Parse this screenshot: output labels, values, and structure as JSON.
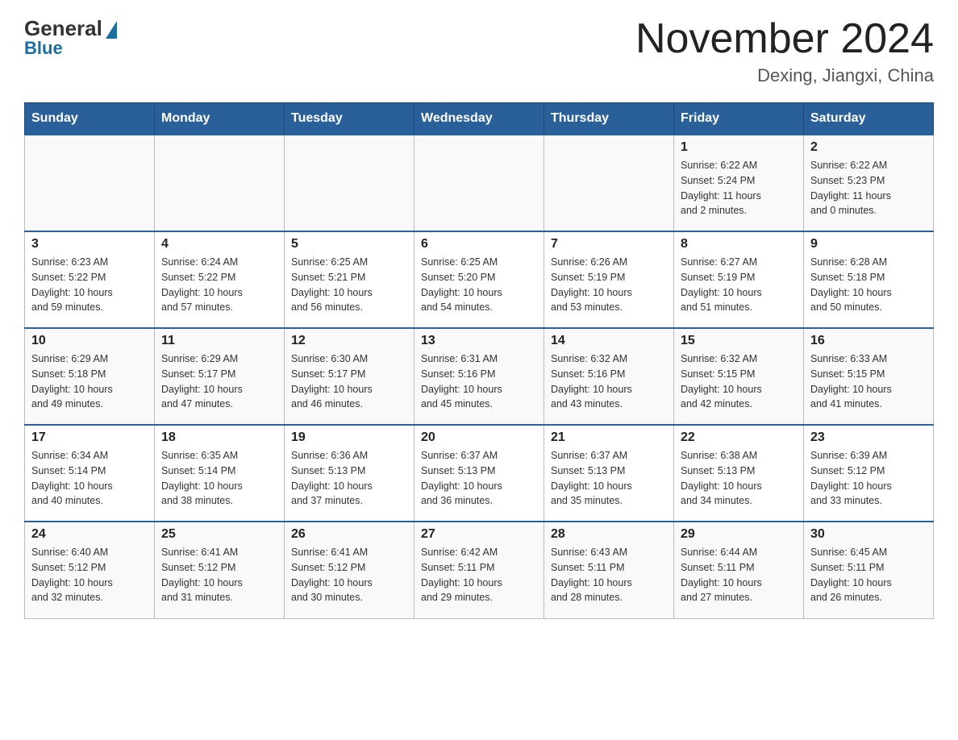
{
  "logo": {
    "general": "General",
    "blue": "Blue"
  },
  "title": "November 2024",
  "location": "Dexing, Jiangxi, China",
  "weekdays": [
    "Sunday",
    "Monday",
    "Tuesday",
    "Wednesday",
    "Thursday",
    "Friday",
    "Saturday"
  ],
  "weeks": [
    [
      {
        "day": "",
        "info": ""
      },
      {
        "day": "",
        "info": ""
      },
      {
        "day": "",
        "info": ""
      },
      {
        "day": "",
        "info": ""
      },
      {
        "day": "",
        "info": ""
      },
      {
        "day": "1",
        "info": "Sunrise: 6:22 AM\nSunset: 5:24 PM\nDaylight: 11 hours\nand 2 minutes."
      },
      {
        "day": "2",
        "info": "Sunrise: 6:22 AM\nSunset: 5:23 PM\nDaylight: 11 hours\nand 0 minutes."
      }
    ],
    [
      {
        "day": "3",
        "info": "Sunrise: 6:23 AM\nSunset: 5:22 PM\nDaylight: 10 hours\nand 59 minutes."
      },
      {
        "day": "4",
        "info": "Sunrise: 6:24 AM\nSunset: 5:22 PM\nDaylight: 10 hours\nand 57 minutes."
      },
      {
        "day": "5",
        "info": "Sunrise: 6:25 AM\nSunset: 5:21 PM\nDaylight: 10 hours\nand 56 minutes."
      },
      {
        "day": "6",
        "info": "Sunrise: 6:25 AM\nSunset: 5:20 PM\nDaylight: 10 hours\nand 54 minutes."
      },
      {
        "day": "7",
        "info": "Sunrise: 6:26 AM\nSunset: 5:19 PM\nDaylight: 10 hours\nand 53 minutes."
      },
      {
        "day": "8",
        "info": "Sunrise: 6:27 AM\nSunset: 5:19 PM\nDaylight: 10 hours\nand 51 minutes."
      },
      {
        "day": "9",
        "info": "Sunrise: 6:28 AM\nSunset: 5:18 PM\nDaylight: 10 hours\nand 50 minutes."
      }
    ],
    [
      {
        "day": "10",
        "info": "Sunrise: 6:29 AM\nSunset: 5:18 PM\nDaylight: 10 hours\nand 49 minutes."
      },
      {
        "day": "11",
        "info": "Sunrise: 6:29 AM\nSunset: 5:17 PM\nDaylight: 10 hours\nand 47 minutes."
      },
      {
        "day": "12",
        "info": "Sunrise: 6:30 AM\nSunset: 5:17 PM\nDaylight: 10 hours\nand 46 minutes."
      },
      {
        "day": "13",
        "info": "Sunrise: 6:31 AM\nSunset: 5:16 PM\nDaylight: 10 hours\nand 45 minutes."
      },
      {
        "day": "14",
        "info": "Sunrise: 6:32 AM\nSunset: 5:16 PM\nDaylight: 10 hours\nand 43 minutes."
      },
      {
        "day": "15",
        "info": "Sunrise: 6:32 AM\nSunset: 5:15 PM\nDaylight: 10 hours\nand 42 minutes."
      },
      {
        "day": "16",
        "info": "Sunrise: 6:33 AM\nSunset: 5:15 PM\nDaylight: 10 hours\nand 41 minutes."
      }
    ],
    [
      {
        "day": "17",
        "info": "Sunrise: 6:34 AM\nSunset: 5:14 PM\nDaylight: 10 hours\nand 40 minutes."
      },
      {
        "day": "18",
        "info": "Sunrise: 6:35 AM\nSunset: 5:14 PM\nDaylight: 10 hours\nand 38 minutes."
      },
      {
        "day": "19",
        "info": "Sunrise: 6:36 AM\nSunset: 5:13 PM\nDaylight: 10 hours\nand 37 minutes."
      },
      {
        "day": "20",
        "info": "Sunrise: 6:37 AM\nSunset: 5:13 PM\nDaylight: 10 hours\nand 36 minutes."
      },
      {
        "day": "21",
        "info": "Sunrise: 6:37 AM\nSunset: 5:13 PM\nDaylight: 10 hours\nand 35 minutes."
      },
      {
        "day": "22",
        "info": "Sunrise: 6:38 AM\nSunset: 5:13 PM\nDaylight: 10 hours\nand 34 minutes."
      },
      {
        "day": "23",
        "info": "Sunrise: 6:39 AM\nSunset: 5:12 PM\nDaylight: 10 hours\nand 33 minutes."
      }
    ],
    [
      {
        "day": "24",
        "info": "Sunrise: 6:40 AM\nSunset: 5:12 PM\nDaylight: 10 hours\nand 32 minutes."
      },
      {
        "day": "25",
        "info": "Sunrise: 6:41 AM\nSunset: 5:12 PM\nDaylight: 10 hours\nand 31 minutes."
      },
      {
        "day": "26",
        "info": "Sunrise: 6:41 AM\nSunset: 5:12 PM\nDaylight: 10 hours\nand 30 minutes."
      },
      {
        "day": "27",
        "info": "Sunrise: 6:42 AM\nSunset: 5:11 PM\nDaylight: 10 hours\nand 29 minutes."
      },
      {
        "day": "28",
        "info": "Sunrise: 6:43 AM\nSunset: 5:11 PM\nDaylight: 10 hours\nand 28 minutes."
      },
      {
        "day": "29",
        "info": "Sunrise: 6:44 AM\nSunset: 5:11 PM\nDaylight: 10 hours\nand 27 minutes."
      },
      {
        "day": "30",
        "info": "Sunrise: 6:45 AM\nSunset: 5:11 PM\nDaylight: 10 hours\nand 26 minutes."
      }
    ]
  ]
}
